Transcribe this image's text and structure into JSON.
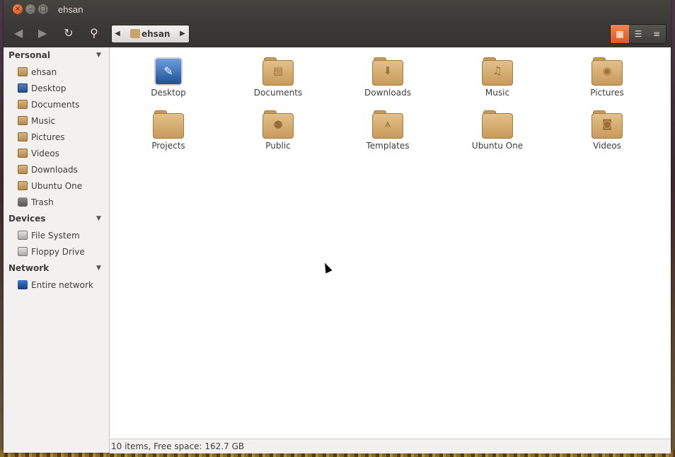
{
  "window": {
    "title": "ehsan"
  },
  "toolbar": {
    "path_crumb": "ehsan"
  },
  "sidebar": {
    "sections": [
      {
        "title": "Personal",
        "items": [
          {
            "label": "ehsan",
            "icon": "home-folder-icon"
          },
          {
            "label": "Desktop",
            "icon": "desktop-icon"
          },
          {
            "label": "Documents",
            "icon": "documents-folder-icon"
          },
          {
            "label": "Music",
            "icon": "music-folder-icon"
          },
          {
            "label": "Pictures",
            "icon": "pictures-folder-icon"
          },
          {
            "label": "Videos",
            "icon": "videos-folder-icon"
          },
          {
            "label": "Downloads",
            "icon": "downloads-folder-icon"
          },
          {
            "label": "Ubuntu One",
            "icon": "folder-icon"
          },
          {
            "label": "Trash",
            "icon": "trash-icon"
          }
        ]
      },
      {
        "title": "Devices",
        "items": [
          {
            "label": "File System",
            "icon": "drive-icon"
          },
          {
            "label": "Floppy Drive",
            "icon": "floppy-icon"
          }
        ]
      },
      {
        "title": "Network",
        "items": [
          {
            "label": "Entire network",
            "icon": "network-icon"
          }
        ]
      }
    ]
  },
  "files": [
    {
      "label": "Desktop",
      "icon": "desktop-icon"
    },
    {
      "label": "Documents",
      "icon": "documents-folder-icon",
      "glyph": "▤"
    },
    {
      "label": "Downloads",
      "icon": "downloads-folder-icon",
      "glyph": "⬇"
    },
    {
      "label": "Music",
      "icon": "music-folder-icon",
      "glyph": "♫"
    },
    {
      "label": "Pictures",
      "icon": "pictures-folder-icon",
      "glyph": "◉"
    },
    {
      "label": "Projects",
      "icon": "folder-icon",
      "glyph": ""
    },
    {
      "label": "Public",
      "icon": "public-folder-icon",
      "glyph": "●"
    },
    {
      "label": "Templates",
      "icon": "templates-folder-icon",
      "glyph": "⩚"
    },
    {
      "label": "Ubuntu One",
      "icon": "folder-icon",
      "glyph": ""
    },
    {
      "label": "Videos",
      "icon": "videos-folder-icon",
      "glyph": "◙"
    }
  ],
  "status": {
    "text": "10 items, Free space: 162.7 GB"
  },
  "colors": {
    "accent": "#df5a1f",
    "folder": "#c89a5a",
    "titlebar": "#3c3b37"
  }
}
